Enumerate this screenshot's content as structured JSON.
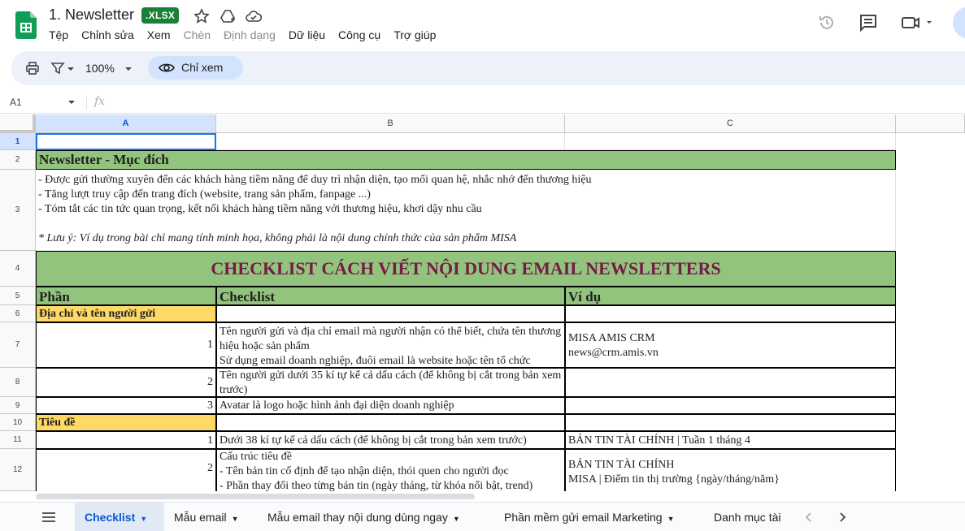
{
  "window": {
    "title": "1. Newsletter",
    "badge": ".XLSX",
    "icons": [
      "sheets-logo-icon",
      "star-icon",
      "move-to-drive-icon",
      "cloud-status-icon",
      "history-icon",
      "comments-icon",
      "meet-video-icon",
      "account-avatar"
    ]
  },
  "menu": [
    "Tệp",
    "Chỉnh sửa",
    "Xem",
    "Chèn",
    "Định dạng",
    "Dữ liệu",
    "Công cụ",
    "Trợ giúp"
  ],
  "toolbar": {
    "zoom": "100%",
    "view_only_label": "Chỉ xem"
  },
  "formula_bar": {
    "name_box": "A1",
    "fx": "fx"
  },
  "columns": [
    "A",
    "B",
    "C"
  ],
  "rows": [
    "1",
    "2",
    "3",
    "4",
    "5",
    "6",
    "7",
    "8",
    "9",
    "10",
    "11",
    "12"
  ],
  "sheet": {
    "r2": "Newsletter - Mục đích",
    "r3": {
      "line1": "- Được gửi thường xuyên đến các khách hàng tiềm năng để duy trì nhận diện, tạo mối quan hệ, nhắc nhớ đến thương hiệu",
      "line2": "- Tăng lượt truy cập đến trang đích (website, trang sản phẩm, fanpage ...)",
      "line3": "- Tóm tắt các tin tức quan trọng, kết nối khách hàng tiềm năng với thương hiệu, khơi dậy nhu cầu",
      "note": "* Lưu ý: Ví dụ trong bài chỉ mang tính minh họa, không phải là nội dung chính thức của sản phẩm MISA"
    },
    "r4": "CHECKLIST CÁCH VIẾT NỘI DUNG EMAIL NEWSLETTERS",
    "r5": {
      "a": "Phần",
      "b": "Checklist",
      "c": "Ví dụ"
    },
    "r6": "Địa chỉ và tên người gửi",
    "r7": {
      "num": "1",
      "b": "Tên người gửi và địa chỉ email mà người nhận có thể biết, chứa tên thương hiệu hoặc sản phẩm",
      "b2": "Sử dụng email doanh nghiệp, đuôi email là website hoặc tên tổ chức",
      "c1": "MISA AMIS CRM",
      "c2": "news@crm.amis.vn"
    },
    "r8": {
      "num": "2",
      "b": "Tên người gửi dưới 35 kí tự kể cả dấu cách (để không bị cắt trong bản xem trước)"
    },
    "r9": {
      "num": "3",
      "b": "Avatar là logo hoặc hình ảnh đại diện doanh nghiệp"
    },
    "r10": "Tiêu đề",
    "r11": {
      "num": "1",
      "b": "Dưới 38 kí tự kể cả dấu cách (để không bị cắt trong bản xem trước)",
      "c": "BẢN TIN TÀI CHÍNH | Tuần 1 tháng 4"
    },
    "r12": {
      "num": "2",
      "b1": "Cấu trúc tiêu đề",
      "b2": "- Tên bản tin cố định để tạo nhận diện, thói quen cho người đọc",
      "b3": "- Phần thay đổi theo từng bản tin (ngày tháng, từ khóa nổi bật, trend)",
      "c1": "BẢN TIN TÀI CHÍNH",
      "c2": "MISA | Điểm tin thị trường {ngày/tháng/năm}"
    }
  },
  "tabs": [
    "Checklist",
    "Mẫu email",
    "Mẫu email thay nội dung dùng ngay",
    "Phần mềm gửi email Marketing",
    "Danh mục tài"
  ],
  "colors": {
    "header_green": "#93c47d",
    "section_yellow": "#ffd966",
    "title_maroon": "#741b47",
    "accent_blue": "#0b57d0",
    "badge_green": "#188038"
  }
}
